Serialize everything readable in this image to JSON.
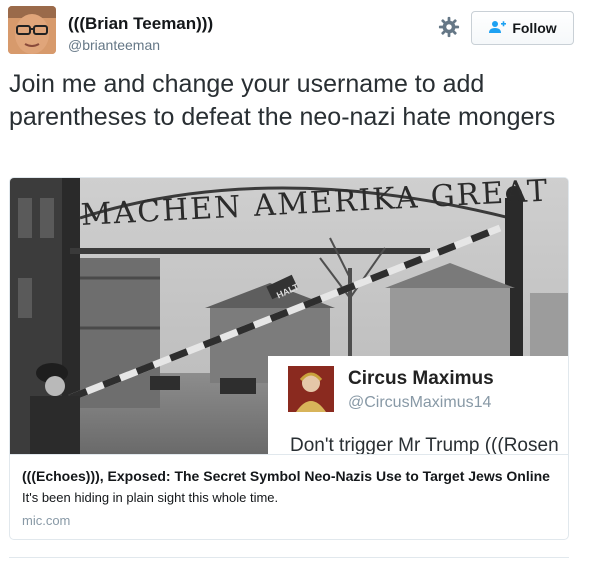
{
  "author": {
    "name": "(((Brian Teeman)))",
    "handle": "@brianteeman"
  },
  "actions": {
    "settings_icon": "gear-icon",
    "follow_icon": "add-user-icon",
    "follow_label": "Follow"
  },
  "tweet": {
    "text": "Join me and change your username to add parentheses to defeat the neo-nazi hate mongers"
  },
  "card": {
    "image": {
      "sign_text": "MACHEN AMERIKA GREAT",
      "halt_sign": "HALT",
      "inset_tweet": {
        "name": "Circus Maximus",
        "handle": "@CircusMaximus14",
        "text": "Don't trigger Mr Trump (((Rosen"
      }
    },
    "title": "(((Echoes))), Exposed: The Secret Symbol Neo-Nazis Use to Target Jews Online",
    "description": "It's been hiding in plain sight this whole time.",
    "domain": "mic.com"
  },
  "colors": {
    "link_gray": "#8899a6",
    "border": "#e1e8ed",
    "follow_icon": "#1da1f2"
  }
}
